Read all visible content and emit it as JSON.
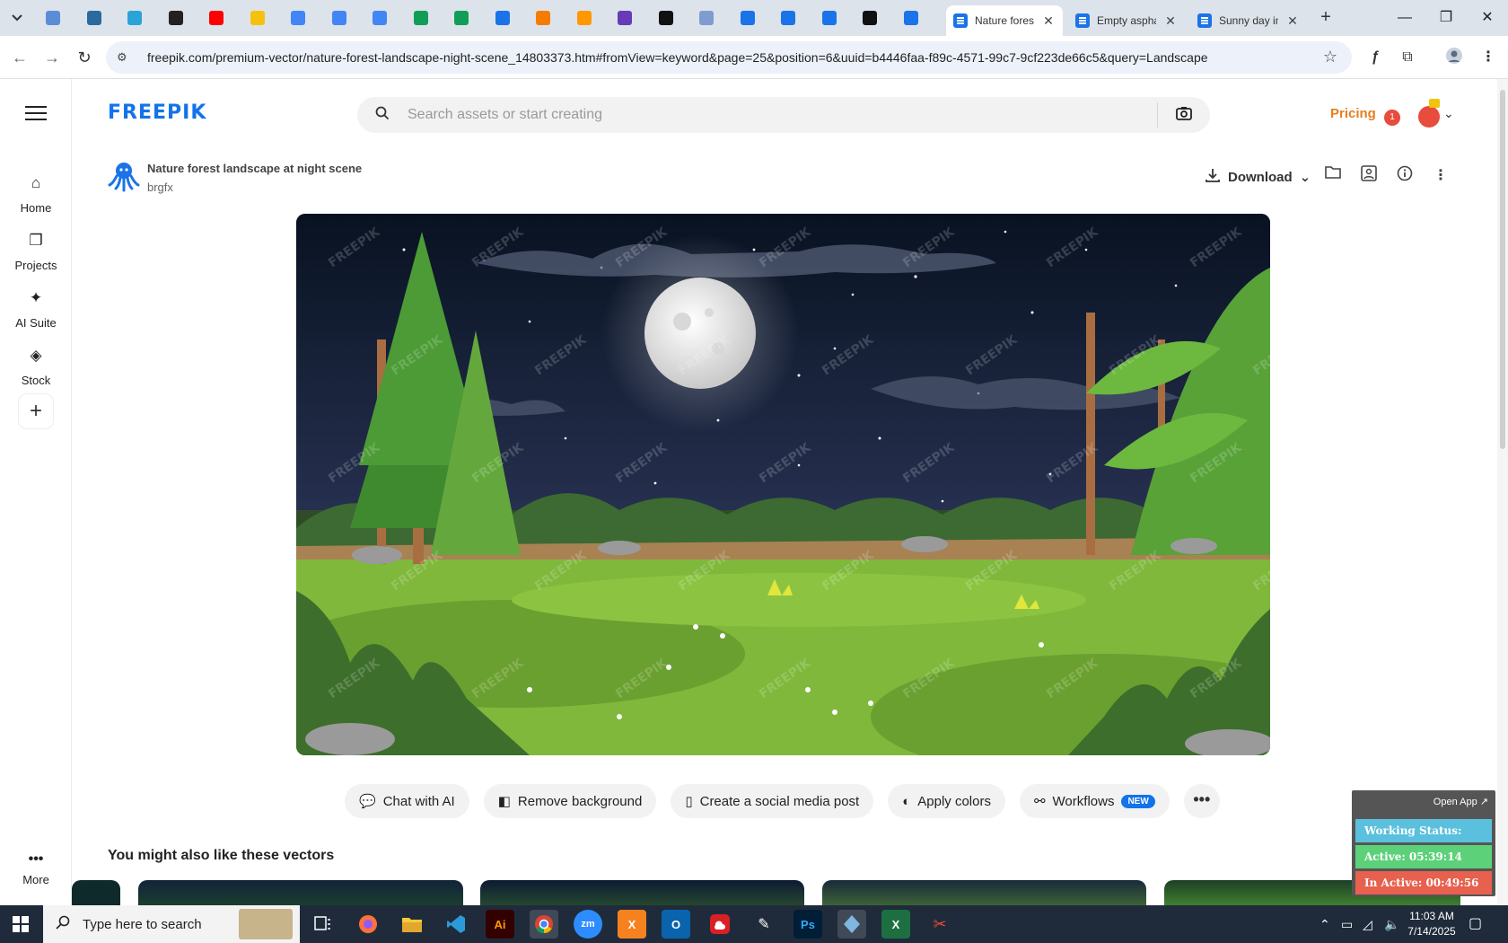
{
  "browser": {
    "tabs": [
      {
        "title": "Nature forest",
        "active": true
      },
      {
        "title": "Empty asphalt",
        "active": false
      },
      {
        "title": "Sunny day in",
        "active": false
      }
    ],
    "new_tab": "+",
    "window_controls": {
      "minimize": "—",
      "restore": "❐",
      "close": "✕"
    },
    "url": "freepik.com/premium-vector/nature-forest-landscape-night-scene_14803373.htm#fromView=keyword&page=25&position=6&uuid=b4446faa-f89c-4571-99c7-9cf223de66c5&query=Landscape",
    "pinned_tab_colors": [
      "#5b8dd6",
      "#2a6a9e",
      "#2aa3d8",
      "#222222",
      "#ff0000",
      "#f4c20d",
      "#4285f4",
      "#4285f4",
      "#4285f4",
      "#0f9d58",
      "#0f9d58",
      "#1a73e8",
      "#f57c00",
      "#ff9800",
      "#673ab7",
      "#111111",
      "#7e9ccf",
      "#1a73e8",
      "#1a73e8",
      "#1a73e8",
      "#111111",
      "#1a73e8"
    ]
  },
  "freepik": {
    "logo": "FREEPIK",
    "search_placeholder": "Search assets or start creating",
    "pricing": "Pricing",
    "notification_count": "1",
    "nav": {
      "home": "Home",
      "projects": "Projects",
      "ai_suite": "AI Suite",
      "stock": "Stock",
      "more": "More"
    },
    "asset": {
      "title": "Nature forest landscape at night scene",
      "author": "brgfx",
      "download": "Download"
    },
    "actions": {
      "chat_ai": "Chat with AI",
      "remove_bg": "Remove background",
      "social_post": "Create a social media post",
      "apply_colors": "Apply colors",
      "workflows": "Workflows",
      "new_badge": "NEW",
      "more": "•••"
    },
    "related_title": "You might also like these vectors",
    "watermark": "FREEPIK"
  },
  "status_widget": {
    "open_app": "Open App ↗",
    "working_status": "Working Status: Active",
    "active": "Active: 05:39:14",
    "inactive": "In Active: 00:49:56",
    "colors": {
      "working": "#5bc0de",
      "active": "#5cd17a",
      "inactive": "#e8614e"
    }
  },
  "taskbar": {
    "search_placeholder": "Type here to search",
    "time": "11:03 AM",
    "date": "7/14/2025",
    "apps": [
      {
        "label": "Ai",
        "color": "#330000",
        "text": "#ff9a00"
      },
      {
        "label": "zm",
        "color": "#2d8cff",
        "text": "#ffffff"
      },
      {
        "label": "X",
        "color": "#f6821f",
        "text": "#ffffff"
      },
      {
        "label": "O",
        "color": "#0a64ad",
        "text": "#ffffff"
      },
      {
        "label": "Ps",
        "color": "#001e36",
        "text": "#31a8ff"
      },
      {
        "label": "X",
        "color": "#1d6f42",
        "text": "#ffffff"
      }
    ]
  },
  "colors": {
    "brand": "#1273eb",
    "pricing": "#e67e22",
    "taskbar_bg": "#1f2b3a",
    "tabstrip_bg": "#dde3ea"
  }
}
